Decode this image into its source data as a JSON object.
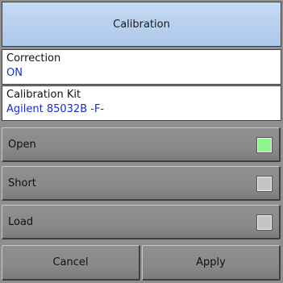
{
  "title": "Calibration",
  "correction": {
    "label": "Correction",
    "value": "ON"
  },
  "cal_kit": {
    "label": "Calibration Kit",
    "value": "Agilent 85032B -F-"
  },
  "buttons": [
    {
      "label": "Open",
      "indicator_color": "#8ef58e"
    },
    {
      "label": "Short",
      "indicator_color": "#c4c4c4"
    },
    {
      "label": "Load",
      "indicator_color": "#c4c4c4"
    }
  ],
  "footer": {
    "cancel": "Cancel",
    "apply": "Apply"
  }
}
